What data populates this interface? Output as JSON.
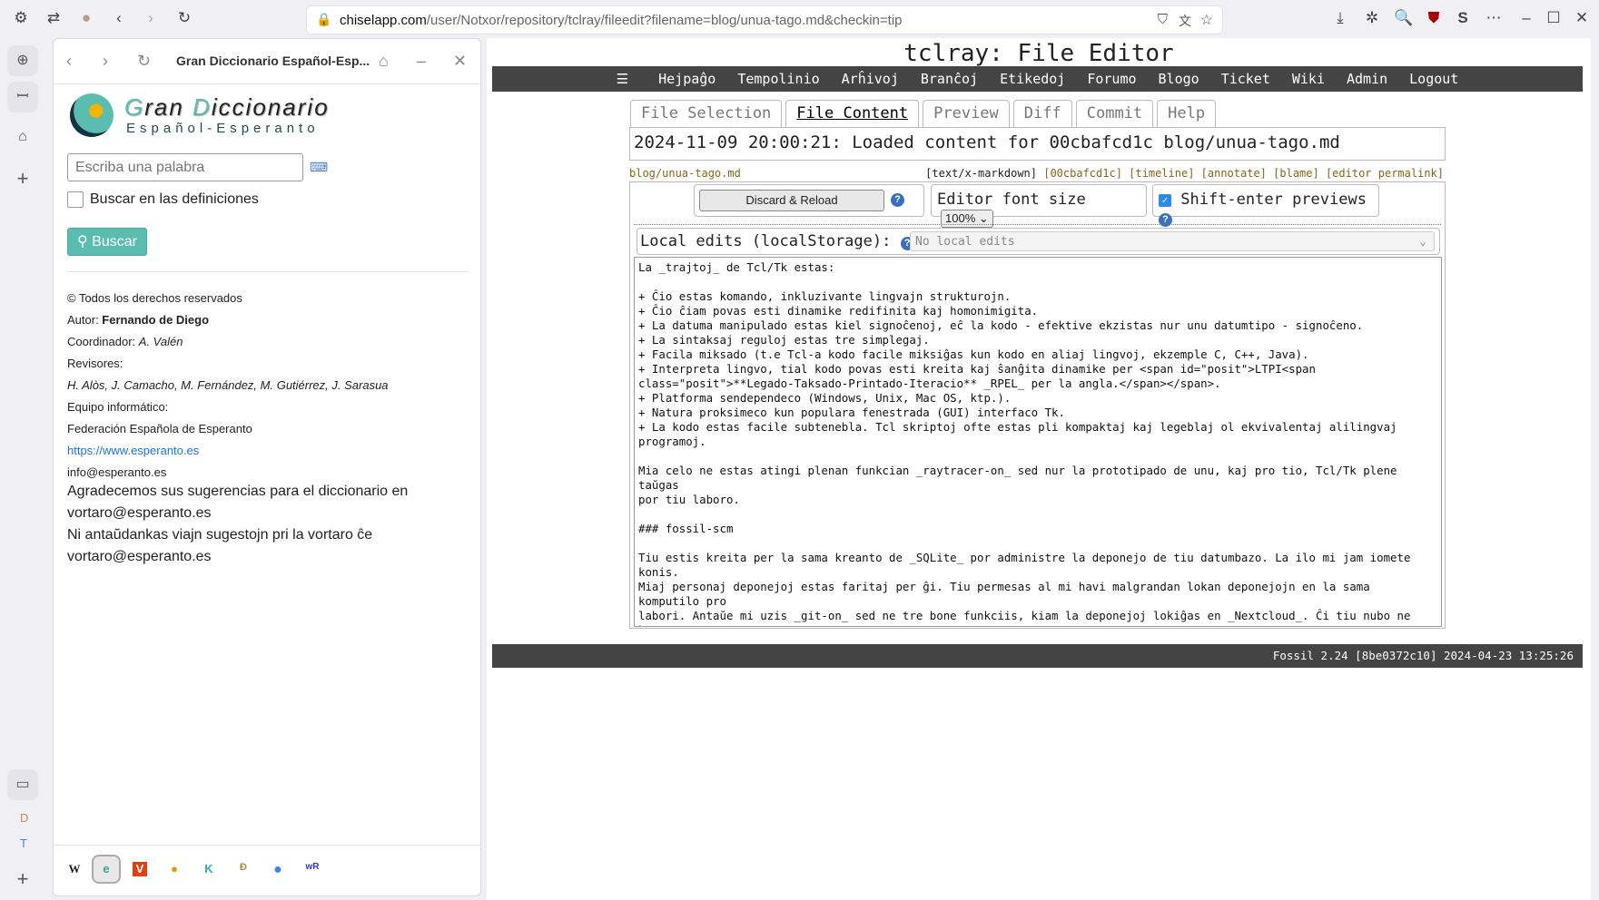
{
  "browser": {
    "url_host": "chiselapp.com",
    "url_path": "/user/Notxor/repository/tclray/fileedit?filename=blog/unua-tago.md&checkin=tip"
  },
  "sidebar_panel": {
    "title": "Gran Diccionario Español-Esp...",
    "logo_line1_a": "G",
    "logo_line1_b": "ran ",
    "logo_line1_c": "D",
    "logo_line1_d": "iccionario",
    "logo_line2": "Español-Esperanto",
    "search_placeholder": "Escriba una palabra",
    "checkbox_label": "Buscar en las definiciones",
    "search_button": "Buscar",
    "credits": {
      "copyright": "© Todos los derechos reservados",
      "author_label": "Autor: ",
      "author": "Fernando de Diego",
      "coord_label": "Coordinador: ",
      "coord": "A. Valén",
      "reviewers_label": "Revisores:",
      "reviewers": "H. Alòs, J. Camacho, M. Fernández, M. Gutiérrez, J. Sarasua",
      "team_label": "Equipo informático:",
      "team": "Federación Española de Esperanto",
      "link": "https://www.esperanto.es",
      "email": "info@esperanto.es"
    },
    "thanks": [
      "Agradecemos sus sugerencias para el diccionario en",
      "vortaro@esperanto.es",
      "Ni antaŭdankas viajn sugestojn pri la vortaro ĉe",
      "vortaro@esperanto.es"
    ],
    "strip_letters": [
      "D",
      "T"
    ]
  },
  "page": {
    "title": "tclray: File Editor",
    "nav": [
      "Hejpaĝo",
      "Tempolinio",
      "Arĥivoj",
      "Branĉoj",
      "Etikedoj",
      "Forumo",
      "Blogo",
      "Ticket",
      "Wiki",
      "Admin",
      "Logout"
    ],
    "tabs": [
      "File Selection",
      "File Content",
      "Preview",
      "Diff",
      "Commit",
      "Help"
    ],
    "active_tab": "File Content",
    "status": "2024-11-09 20:00:21: Loaded content for 00cbafcd1c blog/unua-tago.md",
    "filename": "blog/unua-tago.md",
    "mimetype": "[text/x-markdown]",
    "links": [
      "[00cbafcd1c]",
      "[timeline]",
      "[annotate]",
      "[blame]",
      "[editor permalink]"
    ],
    "discard": "Discard & Reload",
    "font_size_label": "Editor font size",
    "font_size": "100%",
    "shift_enter": "Shift-enter previews",
    "shift_enter_checked": true,
    "local_edits_label": "Local edits (localStorage):",
    "local_edits_value": "No local edits",
    "content": "La _trajtoj_ de Tcl/Tk estas:\n\n+ Ĉio estas komando, inkluzivante lingvajn strukturojn.\n+ Ĉio ĉiam povas esti dinamike redifinita kaj homonimigita.\n+ La datuma manipulado estas kiel signoĉenoj, eĉ la kodo - efektive ekzistas nur unu datumtipo - signoĉeno.\n+ La sintaksaj reguloj estas tre simplegaj.\n+ Facila miksado (t.e Tcl-a kodo facile miksiĝas kun kodo en aliaj lingvoj, ekzemple C, C++, Java).\n+ Interpreta lingvo, tial kodo povas esti kreita kaj ŝanĝita dinamike per <span id=\"posit\">LTPI<span\nclass=\"posit\">**Legado-Taksado-Printado-Iteracio** _RPEL_ per la angla.</span></span>.\n+ Platforma sendependeco (Windows, Unix, Mac OS, ktp.).\n+ Natura proksimeco kun populara fenestrada (GUI) interfaco Tk.\n+ La kodo estas facile subtenebla. Tcl skriptoj ofte estas pli kompaktaj kaj legeblaj ol ekvivalentaj alilingvaj\nprogramoj.\n\nMia celo ne estas atingi plenan funkcian _raytracer-on_ sed nur la prototipado de unu, kaj pro tio, Tcl/Tk plene taŭgas\npor tiu laboro.\n\n### fossil-scm\n\nTiu estis kreita per la sama kreanto de _SQLite_ por administre la deponejo de tiu datumbazo. La ilo mi jam iomete konis.\nMiaj personaj deponejoj estas faritaj per ĝi. Tiu permesas al mi havi malgrandan lokan deponejojn en la sama komputilo pro\nlabori. Antaŭe mi uzis _git-on_ sed ne tre bone funkciis, kiam la deponejoj lokiĝas en _Nextcloud_. Ĉi tiu nubo ne bone\ntraktis la kaŝitajn dosierujojn `.git`, kie ĝi gardas la datumojn de la deponejo kaj multaj fojoj mi perdis informon kaj\ntrovis problemojn por sinkronigi la diversajn lokajn deponejojn.",
    "footer": "Fossil 2.24 [8be0372c10] 2024-04-23 13:25:26"
  },
  "colors": {
    "nav_bg": "#444444",
    "link": "#8a6418",
    "accent": "#5bbdb0"
  }
}
